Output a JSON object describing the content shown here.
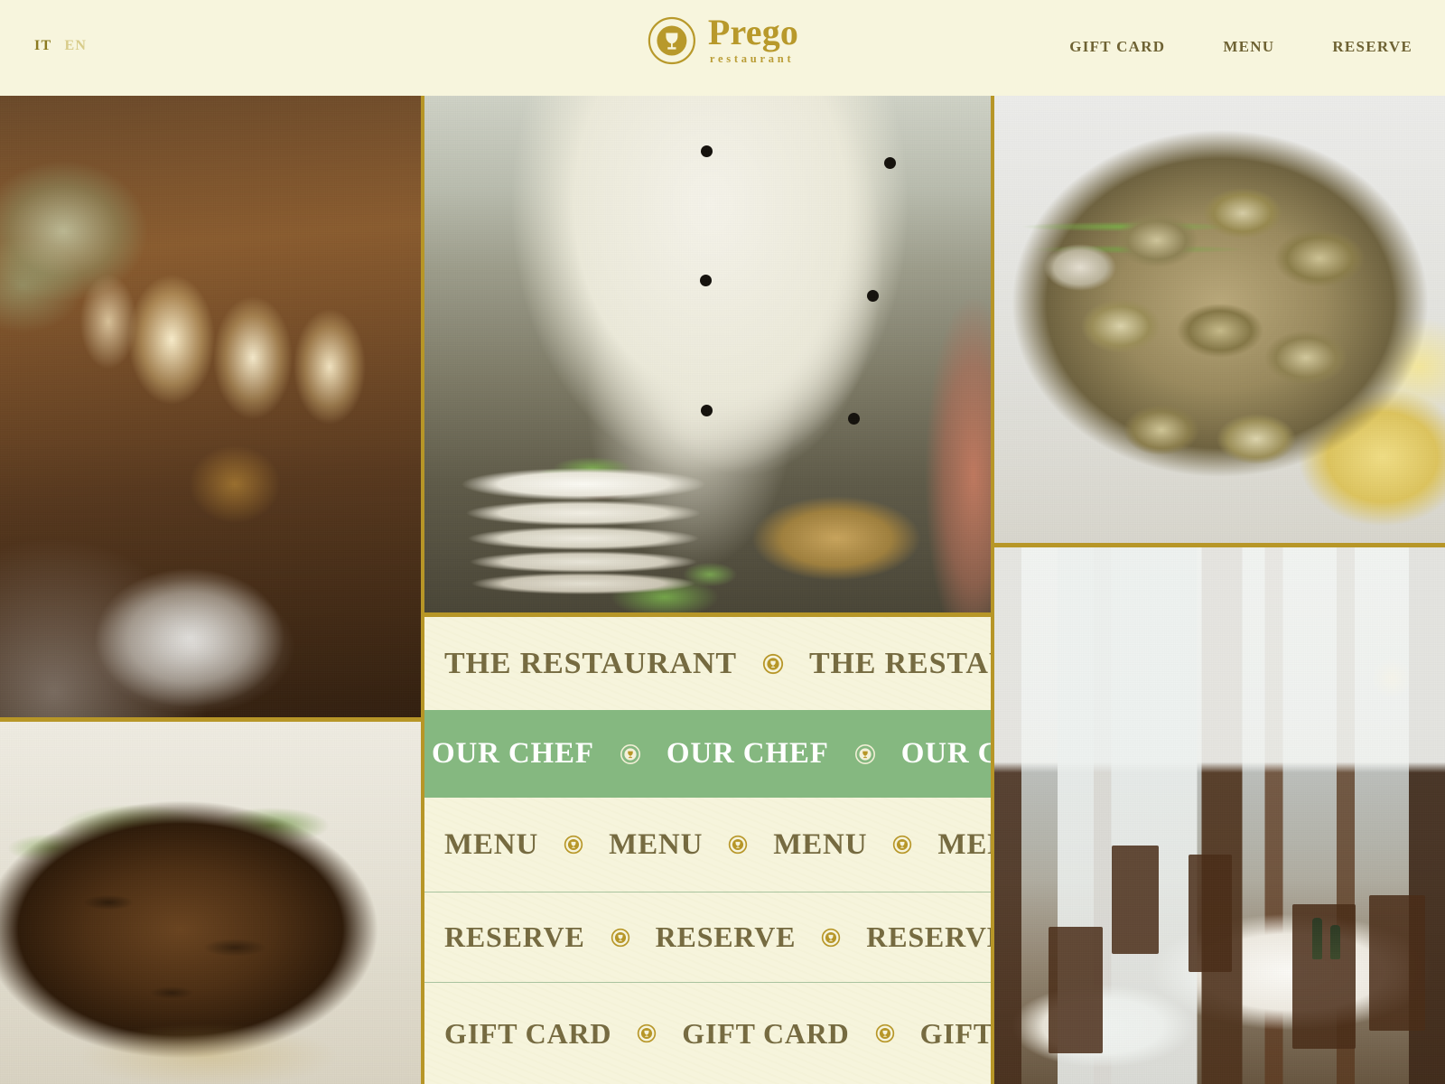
{
  "site": {
    "brand_name": "Prego",
    "brand_sub": "restaurant",
    "logo_icon": "chalice-in-circle-icon"
  },
  "header": {
    "languages": [
      {
        "code": "IT",
        "active": true
      },
      {
        "code": "EN",
        "active": false
      }
    ],
    "nav": [
      {
        "label": "GIFT CARD"
      },
      {
        "label": "MENU"
      },
      {
        "label": "RESERVE"
      }
    ]
  },
  "marquee_rows": [
    {
      "id": "the-restaurant",
      "label": "THE RESTAURANT",
      "state": "default",
      "text_color": "#756A40",
      "bg_color": "#F6F4DC",
      "repeat": 3
    },
    {
      "id": "our-chef",
      "label": "OUR CHEF",
      "state": "active",
      "text_color": "#FFFFFF",
      "bg_color": "#85B880",
      "repeat": 4
    },
    {
      "id": "menu",
      "label": "MENU",
      "state": "default",
      "text_color": "#756A40",
      "bg_color": "#F6F4DC",
      "repeat": 6
    },
    {
      "id": "reserve",
      "label": "RESERVE",
      "state": "default",
      "text_color": "#756A40",
      "bg_color": "#F6F4DC",
      "repeat": 5
    },
    {
      "id": "gift-card",
      "label": "GIFT CARD",
      "state": "default",
      "text_color": "#756A40",
      "bg_color": "#F6F4DC",
      "repeat": 4
    }
  ],
  "gallery": {
    "tiles": [
      {
        "id": "table-setting",
        "alt": "Candlelit table setting with napkin, charger plate and glassware"
      },
      {
        "id": "grilled-steak",
        "alt": "Grilled herb-crusted steak on a white plate"
      },
      {
        "id": "chef-plating",
        "alt": "Chef plating a dish over a stack of white plates"
      },
      {
        "id": "clams-dish",
        "alt": "Plate of clams with spring onion and toasted bread"
      },
      {
        "id": "dining-room",
        "alt": "Dining room interior with set tables and wooden chairs"
      }
    ]
  },
  "theme": {
    "cream": "#F6F4DC",
    "header_cream": "#F7F5DD",
    "gold": "#B79627",
    "gold_logo": "#B8992B",
    "olive_text": "#6E6233",
    "marquee_text": "#756A40",
    "green": "#85B880",
    "green_rule": "#A9C39F",
    "lang_active": "#8B7A20",
    "lang_inactive": "#D8CC8A"
  }
}
